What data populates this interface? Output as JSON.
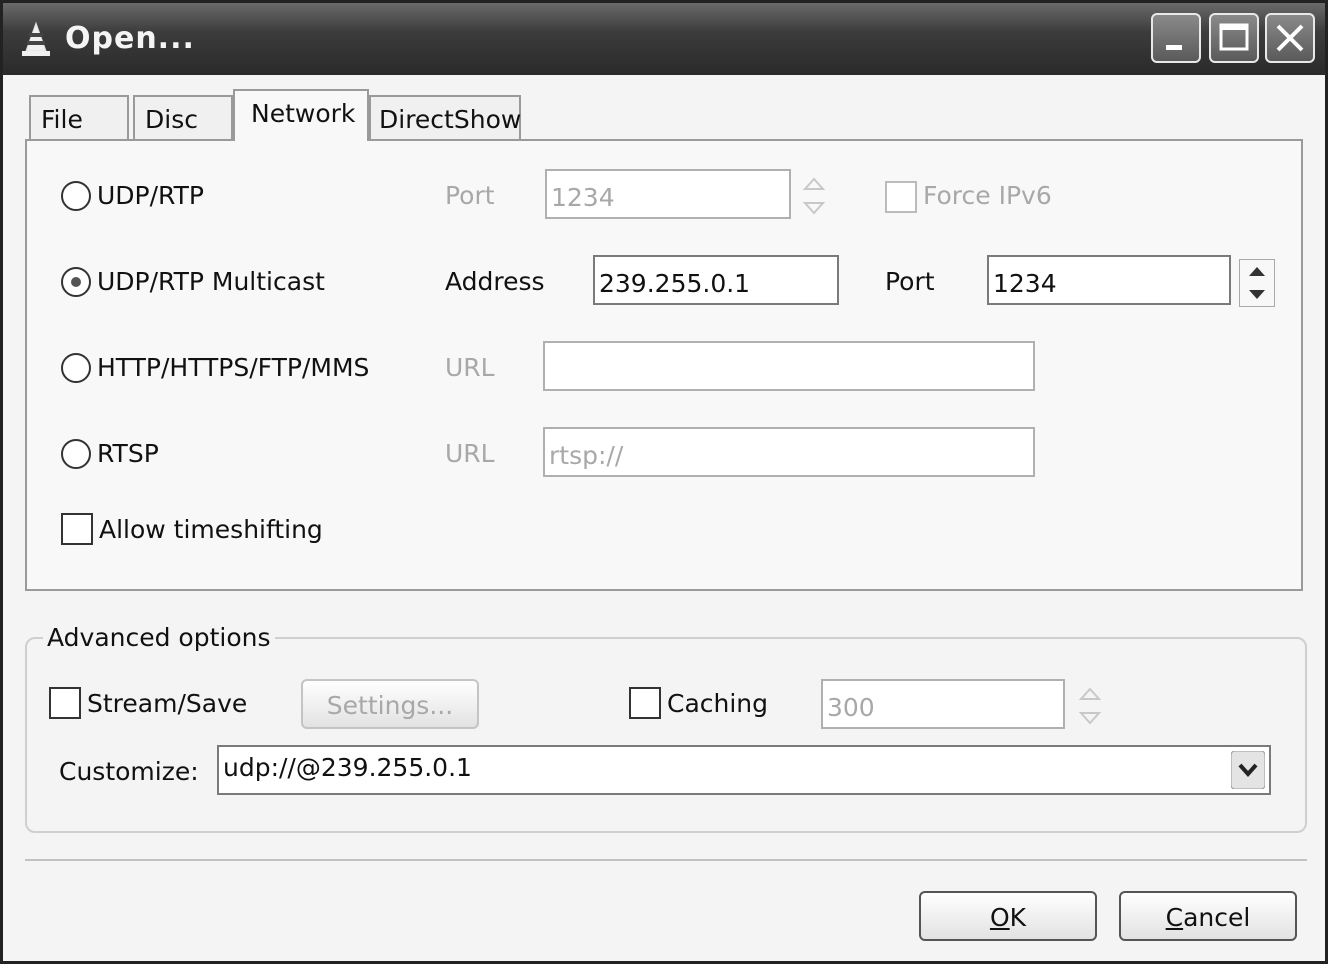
{
  "window": {
    "title": "Open...",
    "controls": [
      "minimize-icon",
      "maximize-icon",
      "close-icon"
    ]
  },
  "tabs": [
    {
      "label": "File",
      "active": false
    },
    {
      "label": "Disc",
      "active": false
    },
    {
      "label": "Network",
      "active": true
    },
    {
      "label": "DirectShow",
      "active": false
    }
  ],
  "network": {
    "udp_rtp": {
      "label": "UDP/RTP",
      "selected": false,
      "port_label": "Port",
      "port_value": "1234",
      "force_ipv6_label": "Force IPv6",
      "enabled": false
    },
    "udp_rtp_multicast": {
      "label": "UDP/RTP Multicast",
      "selected": true,
      "address_label": "Address",
      "address_value": "239.255.0.1",
      "port_label": "Port",
      "port_value": "1234"
    },
    "http": {
      "label": "HTTP/HTTPS/FTP/MMS",
      "selected": false,
      "url_label": "URL",
      "url_value": ""
    },
    "rtsp": {
      "label": "RTSP",
      "selected": false,
      "url_label": "URL",
      "url_value": "rtsp://"
    },
    "timeshift": {
      "label": "Allow timeshifting",
      "checked": false
    }
  },
  "advanced": {
    "title": "Advanced options",
    "stream_save": {
      "label": "Stream/Save",
      "checked": false
    },
    "settings_label": "Settings...",
    "caching": {
      "label": "Caching",
      "checked": false,
      "value": "300"
    },
    "customize_label": "Customize:",
    "customize_value": "udp://@239.255.0.1"
  },
  "buttons": {
    "ok": {
      "label": "OK",
      "mnemonic": "O"
    },
    "cancel": {
      "label": "Cancel",
      "mnemonic": "C"
    }
  }
}
